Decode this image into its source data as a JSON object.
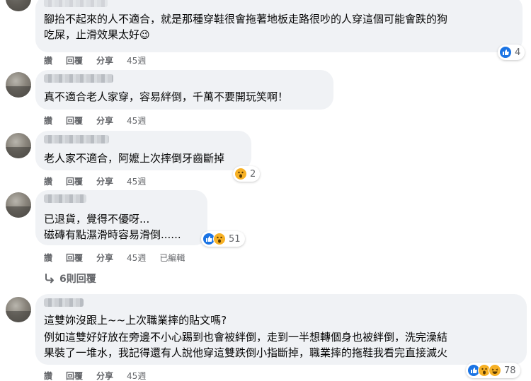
{
  "comments": [
    {
      "lines": [
        "腳抬不起來的人不適合，就是那種穿鞋很會拖著地板走路很吵的人穿這個可能會跌的狗",
        "吃屎，止滑效果太好"
      ],
      "emoji": "😉",
      "actions": {
        "like": "讚",
        "reply": "回覆",
        "share": "分享",
        "time": "45週"
      },
      "reaction_count": "4"
    },
    {
      "lines": [
        "真不適合老人家穿，容易絆倒，千萬不要開玩笑啊！"
      ],
      "actions": {
        "like": "讚",
        "reply": "回覆",
        "share": "分享",
        "time": "45週"
      }
    },
    {
      "lines": [
        "老人家不適合，阿嬤上次摔倒牙齒斷掉"
      ],
      "actions": {
        "like": "讚",
        "reply": "回覆",
        "share": "分享",
        "time": "45週"
      },
      "reaction_count": "2"
    },
    {
      "lines": [
        "已退貨，覺得不優呀...",
        "磁磚有點濕滑時容易滑倒......"
      ],
      "actions": {
        "like": "讚",
        "reply": "回覆",
        "share": "分享",
        "time": "45週",
        "edited": "已編輯"
      },
      "reaction_count": "51"
    },
    {
      "lines": [
        "這雙妳沒跟上~~上次職業摔的貼文嗎?",
        "例如這雙好好放在旁邊不小心踢到也會被絆倒，走到一半想轉個身也被絆倒，洗完澡結",
        "果裝了一堆水，我記得還有人說他穿這雙跌倒小指斷掉，職業摔的拖鞋我看完直接滅火"
      ],
      "actions": {
        "like": "讚",
        "reply": "回覆",
        "share": "分享",
        "time": "45週"
      },
      "reaction_count": "78"
    }
  ],
  "replies_link": "6則回覆",
  "colors": {
    "bubble": "#f0f2f5",
    "like": "#1b74e4",
    "wow": "#f7b125",
    "meta": "#65676b"
  }
}
